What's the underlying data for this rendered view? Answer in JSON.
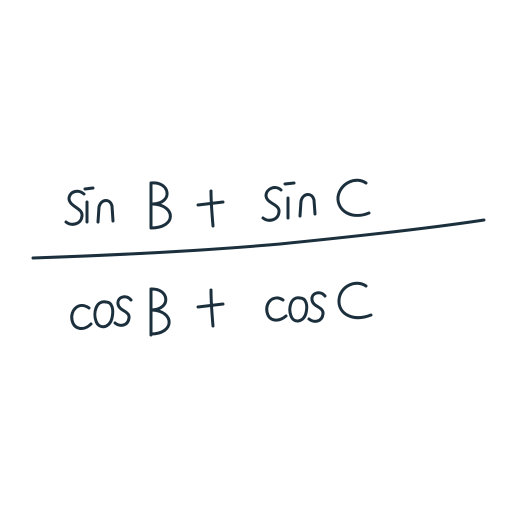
{
  "expression": {
    "numerator": "sin B + sin C",
    "denominator": "cos B + cos C"
  },
  "colors": {
    "ink": "#1b2f3d",
    "background": "#ffffff"
  }
}
